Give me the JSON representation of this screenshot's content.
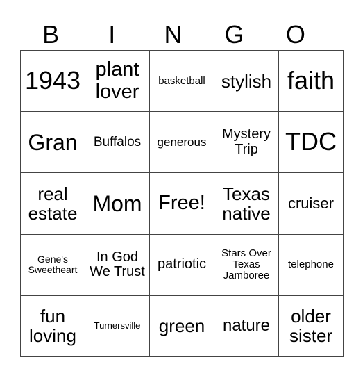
{
  "header": [
    "B",
    "I",
    "N",
    "G",
    "O"
  ],
  "rows": [
    [
      "1943",
      "plant lover",
      "basketball",
      "stylish",
      "faith"
    ],
    [
      "Gran",
      "Buffalos",
      "generous",
      "Mystery Trip",
      "TDC"
    ],
    [
      "real estate",
      "Mom",
      "Free!",
      "Texas native",
      "cruiser"
    ],
    [
      "Gene's Sweetheart",
      "In God We Trust",
      "patriotic",
      "Stars Over Texas Jamboree",
      "telephone"
    ],
    [
      "fun loving",
      "Turnersville",
      "green",
      "nature",
      "older sister"
    ]
  ]
}
